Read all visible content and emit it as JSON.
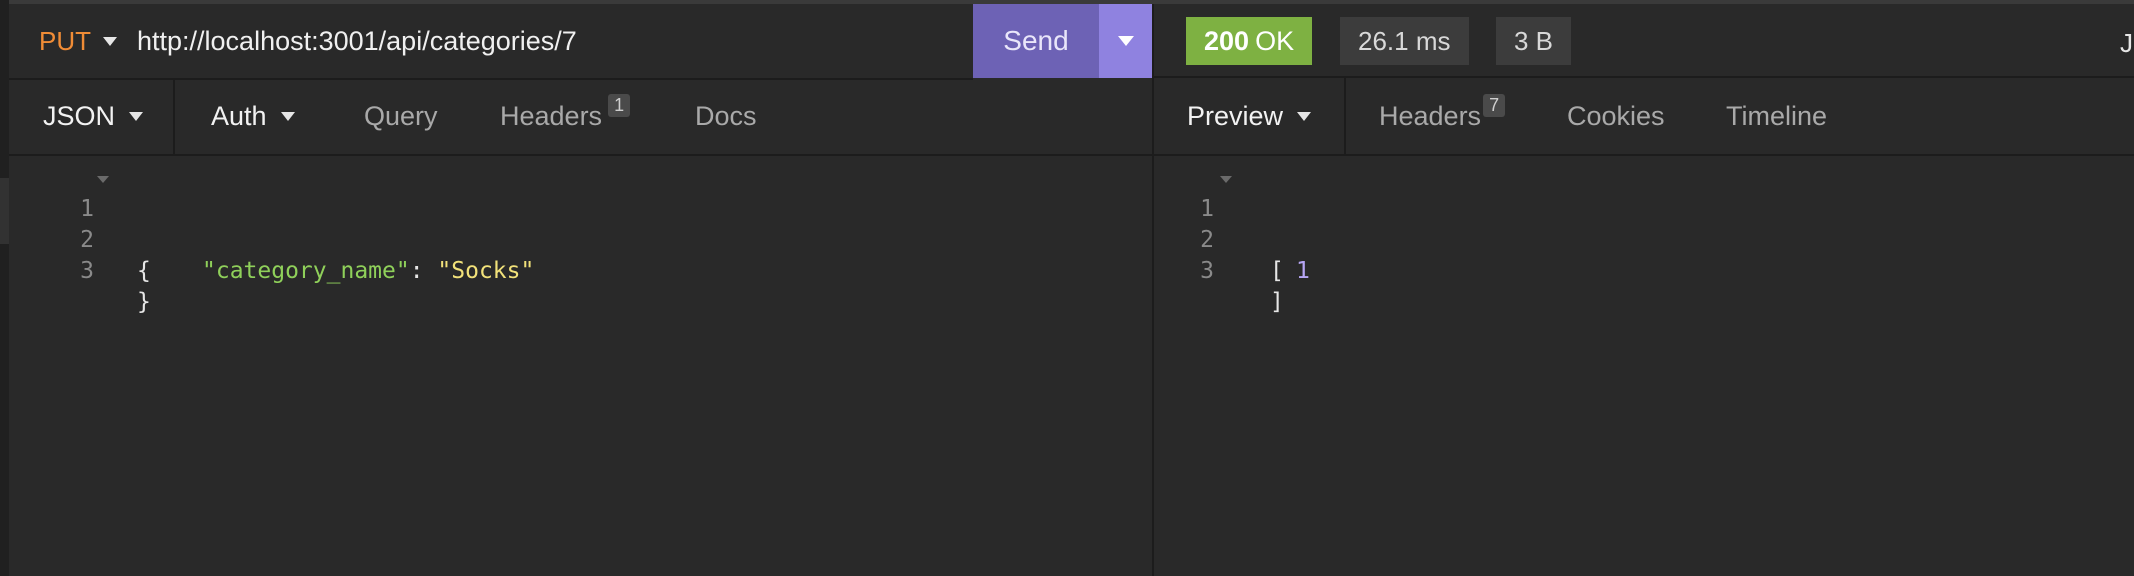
{
  "request": {
    "method": "PUT",
    "url": "http://localhost:3001/api/categories/7",
    "send_label": "Send"
  },
  "response": {
    "status_code": "200",
    "status_text": "OK",
    "time": "26.1 ms",
    "size": "3 B",
    "edge_text": "J"
  },
  "request_tabs": {
    "body_type": "JSON",
    "auth": "Auth",
    "query": "Query",
    "headers": "Headers",
    "headers_count": "1",
    "docs": "Docs"
  },
  "response_tabs": {
    "preview": "Preview",
    "headers": "Headers",
    "headers_count": "7",
    "cookies": "Cookies",
    "timeline": "Timeline"
  },
  "request_body": {
    "line_numbers": [
      "1",
      "2",
      "3"
    ],
    "open": "{",
    "key": "\"category_name\"",
    "colon": ": ",
    "value": "\"Socks\"",
    "close": "}"
  },
  "response_body": {
    "line_numbers": [
      "1",
      "2",
      "3"
    ],
    "open": "[",
    "value": "1",
    "close": "]"
  },
  "colors": {
    "method": "#f08c36",
    "send": "#6d62b5",
    "send_dropdown": "#8f82e0",
    "status_ok": "#7eb142",
    "json_key": "#8fd05a",
    "json_string": "#f2e27a",
    "json_number": "#b7a6f5"
  },
  "icons": {
    "method_dropdown": "caret-down-icon",
    "send_dropdown": "caret-down-icon",
    "fold": "fold-arrow-icon"
  }
}
